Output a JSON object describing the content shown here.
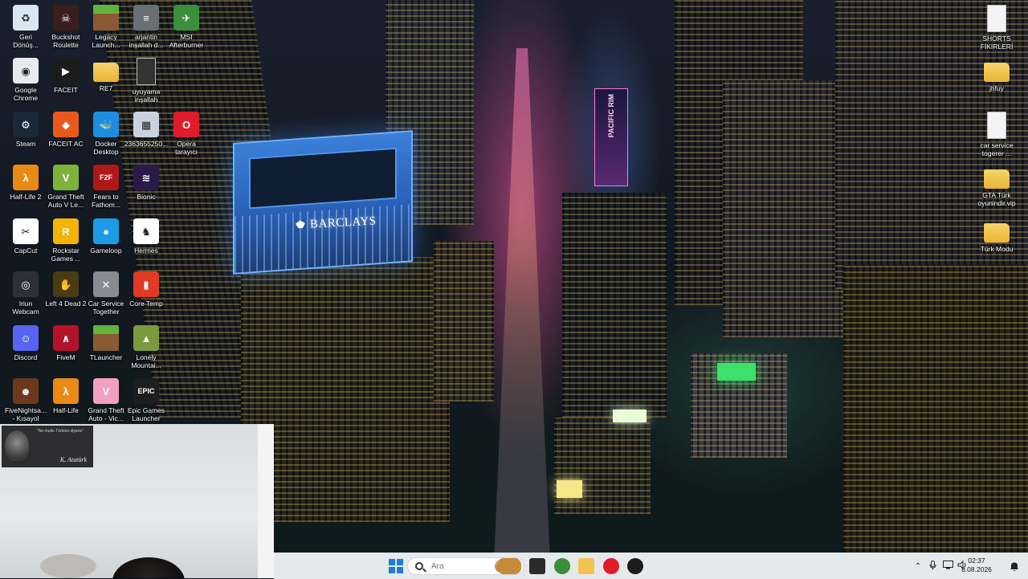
{
  "desktop_icons": [
    {
      "id": "recycle-bin",
      "label": "Geri\nDönüş...",
      "icon": "recycle-bin-icon",
      "color": "#d8e6f2",
      "glyph": "♻"
    },
    {
      "id": "buckshot",
      "label": "Buckshot\nRoulette",
      "icon": "skull-icon",
      "color": "#3a1d1d",
      "glyph": "☠"
    },
    {
      "id": "legacy-launcher",
      "label": "Legacy\nLaunch...",
      "icon": "grass-block-icon",
      "color": "#5d9b3a",
      "glyph": ""
    },
    {
      "id": "arjantin",
      "label": "arjantin\ninşallah d...",
      "icon": "document-thumbnail-icon",
      "color": "#6a6e75",
      "glyph": "≡"
    },
    {
      "id": "msi-afterburner",
      "label": "MSI\nAfterburner",
      "icon": "afterburner-icon",
      "color": "#3a8f3a",
      "glyph": "✈"
    },
    {
      "id": "chrome",
      "label": "Google\nChrome",
      "icon": "chrome-icon",
      "color": "#e8eaed",
      "glyph": "◉"
    },
    {
      "id": "faceit",
      "label": "FACEIT",
      "icon": "faceit-icon",
      "color": "#1c1c1c",
      "glyph": "▶"
    },
    {
      "id": "re7",
      "label": "RE7",
      "icon": "folder-icon",
      "color": "#f2c34e",
      "glyph": ""
    },
    {
      "id": "uyuyama",
      "label": "uyuyama\ninşallah",
      "icon": "blank-file-icon",
      "color": "#333333",
      "glyph": ""
    },
    {
      "id": "steam",
      "label": "Steam",
      "icon": "steam-icon",
      "color": "#1b2838",
      "glyph": "⚙"
    },
    {
      "id": "faceit-ac",
      "label": "FACEIT AC",
      "icon": "faceit-ac-icon",
      "color": "#e9591c",
      "glyph": "◆"
    },
    {
      "id": "docker",
      "label": "Docker\nDesktop",
      "icon": "docker-whale-icon",
      "color": "#1d8de0",
      "glyph": "🐳"
    },
    {
      "id": "file-2363",
      "label": "2363655250...",
      "icon": "image-thumbnail-icon",
      "color": "#c9d3dd",
      "glyph": "▦"
    },
    {
      "id": "opera",
      "label": "Opera\ntarayıcı",
      "icon": "opera-icon",
      "color": "#e21b2b",
      "glyph": "O"
    },
    {
      "id": "half-life-2",
      "label": "Half-Life 2",
      "icon": "lambda-icon",
      "color": "#e88a14",
      "glyph": "λ"
    },
    {
      "id": "gta-v",
      "label": "Grand Theft\nAuto V Le...",
      "icon": "gta-v-icon",
      "color": "#7fb23a",
      "glyph": "V"
    },
    {
      "id": "fears-to-fathom",
      "label": "Fears to\nFathom...",
      "icon": "f2f-icon",
      "color": "#b01818",
      "glyph": "F2F"
    },
    {
      "id": "bionic",
      "label": "Bionic",
      "icon": "bionic-icon",
      "color": "#2a1a4a",
      "glyph": "≋"
    },
    {
      "id": "capcut",
      "label": "CapCut",
      "icon": "capcut-icon",
      "color": "#ffffff",
      "glyph": "✂"
    },
    {
      "id": "rockstar",
      "label": "Rockstar\nGames ...",
      "icon": "rockstar-icon",
      "color": "#f5b400",
      "glyph": "R"
    },
    {
      "id": "gameloop",
      "label": "Gameloop",
      "icon": "gameloop-icon",
      "color": "#1e9be6",
      "glyph": "●"
    },
    {
      "id": "hermes",
      "label": "Hermes",
      "icon": "hermes-icon",
      "color": "#ffffff",
      "glyph": "♞"
    },
    {
      "id": "iriun",
      "label": "Iriun\nWebcam",
      "icon": "webcam-icon",
      "color": "#2f2f3a",
      "glyph": "◎"
    },
    {
      "id": "left4dead2",
      "label": "Left 4 Dead 2",
      "icon": "left4dead-icon",
      "color": "#4a3b12",
      "glyph": "✋"
    },
    {
      "id": "car-service",
      "label": "Car Service\nTogether",
      "icon": "wrench-icon",
      "color": "#888c90",
      "glyph": "✕"
    },
    {
      "id": "core-temp",
      "label": "Core Temp",
      "icon": "thermometer-icon",
      "color": "#e03a24",
      "glyph": "▮"
    },
    {
      "id": "discord",
      "label": "Discord",
      "icon": "discord-icon",
      "color": "#5865f2",
      "glyph": "☺"
    },
    {
      "id": "fivem",
      "label": "FiveM",
      "icon": "fivem-icon",
      "color": "#b3142a",
      "glyph": "∧"
    },
    {
      "id": "tlauncher",
      "label": "TLauncher",
      "icon": "grass-block-icon",
      "color": "#5d9b3a",
      "glyph": ""
    },
    {
      "id": "lonely-mountains",
      "label": "Lonely\nMountai...",
      "icon": "lonely-mountains-icon",
      "color": "#7b9a3c",
      "glyph": "▲"
    },
    {
      "id": "fnaf",
      "label": "FiveNightsa...\n- Kısayol",
      "icon": "freddy-icon",
      "color": "#6b3a1e",
      "glyph": "☻"
    },
    {
      "id": "half-life",
      "label": "Half-Life",
      "icon": "lambda-icon",
      "color": "#e88a14",
      "glyph": "λ"
    },
    {
      "id": "gta-vice",
      "label": "Grand Theft\nAuto - Vic...",
      "icon": "gta-vice-icon",
      "color": "#f0a0c0",
      "glyph": "V"
    },
    {
      "id": "epic",
      "label": "Epic Games\nLauncher",
      "icon": "epic-games-icon",
      "color": "#1e1e1e",
      "glyph": "EPIC"
    },
    {
      "id": "shorts",
      "label": "SHORTS\nFİKİRLERİ",
      "icon": "text-file-icon",
      "color": "#f3f3f3",
      "glyph": ""
    },
    {
      "id": "jhfuy",
      "label": "jhfuy",
      "icon": "folder-icon",
      "color": "#f2c34e",
      "glyph": ""
    },
    {
      "id": "car-service-file",
      "label": "car service\ntogerer ...",
      "icon": "text-file-icon",
      "color": "#f3f3f3",
      "glyph": ""
    },
    {
      "id": "gta-turk",
      "label": "GTA Türk\noyunindir.vip",
      "icon": "folder-icon",
      "color": "#f2c34e",
      "glyph": ""
    },
    {
      "id": "turk-modu",
      "label": "Türk Modu",
      "icon": "folder-icon",
      "color": "#f2c34e",
      "glyph": ""
    }
  ],
  "wallpaper": {
    "barclays_sign": "BARCLAYS",
    "pacific_sign": "PACIFIC RIM"
  },
  "webcam": {
    "poster_text": "\"Ne mutlu Türküm diyene\"",
    "signature": "K. Atatürk"
  },
  "taskbar": {
    "search_placeholder": "Ara",
    "apps": [
      {
        "id": "bread-widget",
        "icon": "bread-icon",
        "color": "#c68a3c"
      },
      {
        "id": "terminal",
        "icon": "terminal-icon",
        "color": "#2b2b2b"
      },
      {
        "id": "chrome",
        "icon": "chrome-icon",
        "color": "#3a8f3a"
      },
      {
        "id": "file-explorer",
        "icon": "folder-icon",
        "color": "#f2c34e"
      },
      {
        "id": "opera",
        "icon": "opera-icon",
        "color": "#e21b2b"
      },
      {
        "id": "recording",
        "icon": "recording-icon",
        "color": "#1b1b1b"
      }
    ],
    "tray": {
      "time": "02:37",
      "date": "8.08.2026"
    }
  }
}
